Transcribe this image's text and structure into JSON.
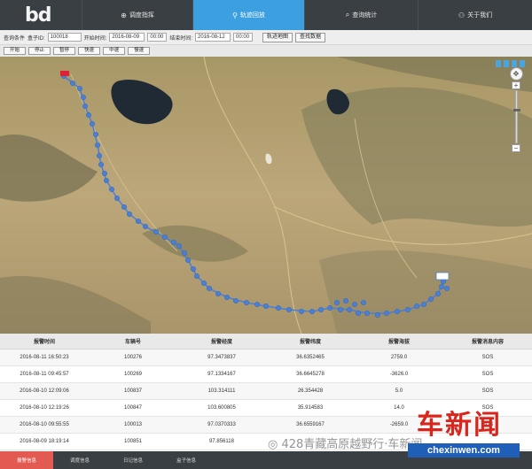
{
  "logo": "bd",
  "nav": {
    "tabs": [
      {
        "label": "调度指挥",
        "icon": "globe-icon",
        "active": false
      },
      {
        "label": "轨迹回放",
        "icon": "location-pin-icon",
        "active": true
      },
      {
        "label": "查询统计",
        "icon": "search-icon",
        "active": false
      },
      {
        "label": "关于我们",
        "icon": "person-icon",
        "active": false
      }
    ]
  },
  "query": {
    "group_label": "查询条件",
    "box_label": "盒子ID:",
    "box_value": "100018",
    "start_label": "开始时间:",
    "start_date": "2016-08-09",
    "start_time": "00:00",
    "end_label": "结束时间:",
    "end_date": "2016-08-12",
    "end_time": "00:00",
    "btn_view": "轨迹地图",
    "btn_data": "查找数据"
  },
  "controls": [
    "开始",
    "停止",
    "暂停",
    "快速",
    "中速",
    "慢速"
  ],
  "map": {
    "badges": [
      "",
      "",
      "",
      ""
    ],
    "start_marker": "起",
    "route_color": "#4a7fd6",
    "zoom_level": 0.35
  },
  "table": {
    "headers": [
      "报警时间",
      "车辆号",
      "报警经度",
      "报警纬度",
      "报警海拔",
      "报警消息内容"
    ],
    "rows": [
      [
        "2016-08-11 16:50:23",
        "100276",
        "97.3473837",
        "36.6352465",
        "2759.0",
        "SOS"
      ],
      [
        "2016-08-11 09:45:57",
        "100269",
        "97.1334167",
        "36.6645278",
        "-3626.0",
        "SOS"
      ],
      [
        "2016-08-10 12:09:06",
        "100837",
        "103.314111",
        "26.354428",
        "5.0",
        "SOS"
      ],
      [
        "2016-08-10 12:19:26",
        "100847",
        "103.600805",
        "35.914583",
        "14.0",
        "SOS"
      ],
      [
        "2016-08-10 09:55:55",
        "100013",
        "97.0370333",
        "36.6559167",
        "-2659.0",
        "SOS"
      ],
      [
        "2016-08-09 18:19:14",
        "100851",
        "97.856118",
        "",
        "",
        ""
      ]
    ]
  },
  "bottom_tabs": [
    "报警信息",
    "调度信息",
    "日记信息",
    "盒子信息"
  ],
  "watermarks": {
    "wechat": "428青藏高原越野行·车新闻",
    "site_cn": "车新闻",
    "site_en": "chexinwen.com"
  },
  "colors": {
    "topbar": "#3a3f44",
    "active_tab": "#3b9fe0",
    "bottom_active": "#e25a52",
    "watermark_red": "#d8261c",
    "watermark_blue": "#1f5fb8"
  }
}
